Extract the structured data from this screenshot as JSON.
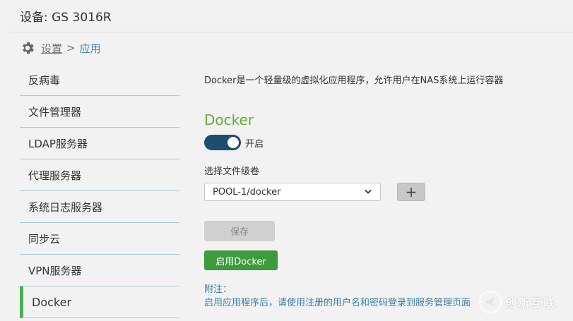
{
  "header": {
    "device_title": "设备: GS 3016R"
  },
  "breadcrumb": {
    "settings": "设置",
    "separator": ">",
    "current": "应用"
  },
  "sidebar": {
    "items": [
      {
        "label": "反病毒"
      },
      {
        "label": "文件管理器"
      },
      {
        "label": "LDAP服务器"
      },
      {
        "label": "代理服务器"
      },
      {
        "label": "系统日志服务器"
      },
      {
        "label": "同步云"
      },
      {
        "label": "VPN服务器"
      },
      {
        "label": "Docker",
        "active": true
      }
    ]
  },
  "main": {
    "intro": "Docker是一个轻量级的虚拟化应用程序，允许用户在NAS系统上运行容器",
    "section_title": "Docker",
    "toggle": {
      "label": "开启",
      "on": true
    },
    "volume_label": "选择文件级卷",
    "volume_select": {
      "value": "POOL-1/docker"
    },
    "add_button": "+",
    "save_button": "保存",
    "enable_button": "启用Docker",
    "note_title": "附注：",
    "note_text": "启用应用程序后，请使用注册的用户名和密码登录到服务管理页面"
  },
  "watermark": {
    "text": "创新互联"
  },
  "colors": {
    "accent_green": "#6aaa3a",
    "button_green": "#3d9a3d",
    "toggle_on": "#1c4f6d",
    "link_blue": "#3a8bb0",
    "active_bar": "#4caf50"
  }
}
